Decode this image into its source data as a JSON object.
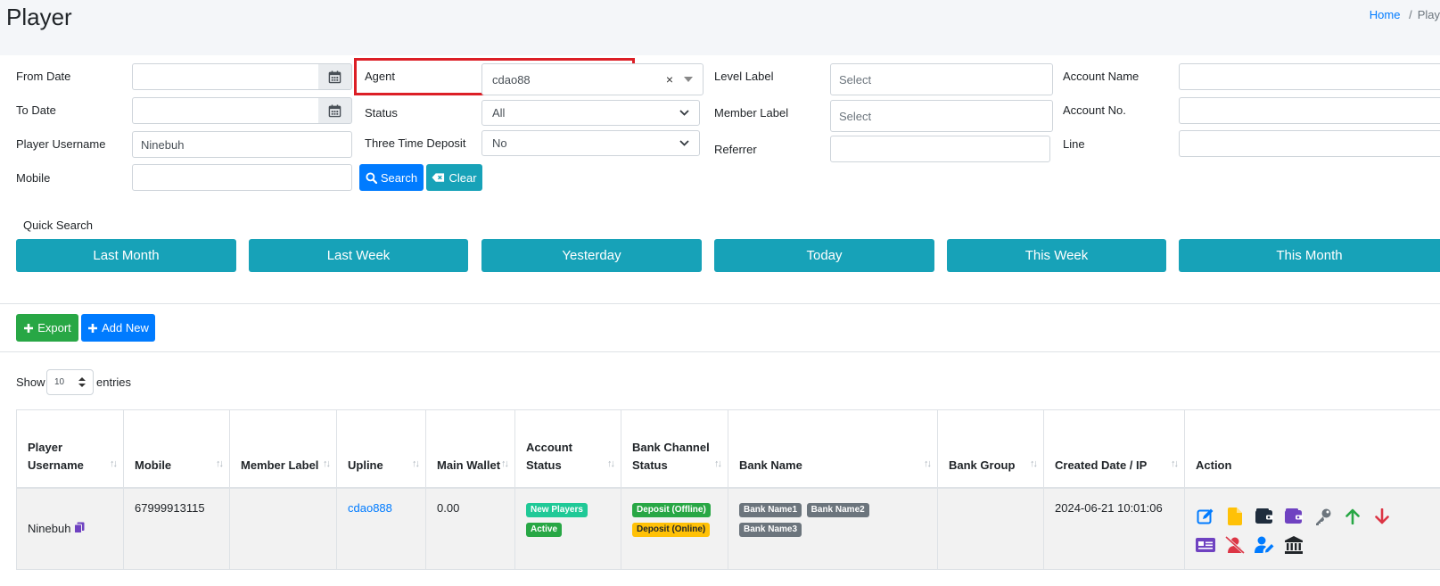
{
  "page": {
    "title": "Player"
  },
  "breadcrumb": {
    "home": "Home",
    "separator": "/",
    "current": "Play"
  },
  "filters": {
    "from_date": {
      "label": "From Date",
      "value": ""
    },
    "to_date": {
      "label": "To Date",
      "value": ""
    },
    "player_username": {
      "label": "Player Username",
      "value": "Ninebuh"
    },
    "mobile": {
      "label": "Mobile",
      "value": ""
    },
    "agent": {
      "label": "Agent",
      "value": "cdao88",
      "clear": "×"
    },
    "status": {
      "label": "Status",
      "value": "All"
    },
    "three_time_deposit": {
      "label": "Three Time Deposit",
      "value": "No"
    },
    "level_label": {
      "label": "Level Label",
      "placeholder": "Select"
    },
    "member_label": {
      "label": "Member Label",
      "placeholder": "Select"
    },
    "referrer": {
      "label": "Referrer",
      "value": ""
    },
    "account_name": {
      "label": "Account Name",
      "value": ""
    },
    "account_no": {
      "label": "Account No.",
      "value": ""
    },
    "line": {
      "label": "Line",
      "value": ""
    },
    "search_button": "Search",
    "clear_button": "Clear"
  },
  "quick_search": {
    "label": "Quick Search",
    "buttons": [
      "Last Month",
      "Last Week",
      "Yesterday",
      "Today",
      "This Week",
      "This Month"
    ]
  },
  "toolbar": {
    "export": "Export",
    "add_new": "Add New"
  },
  "entries": {
    "show": "Show",
    "value": "10",
    "suffix": "entries"
  },
  "table": {
    "columns": [
      "Player Username",
      "Mobile",
      "Member Label",
      "Upline",
      "Main Wallet",
      "Account Status",
      "Bank Channel Status",
      "Bank Name",
      "Bank Group",
      "Created Date / IP",
      "Action"
    ],
    "rows": [
      {
        "player_username": "Ninebuh",
        "mobile": "67999913115",
        "member_label": "",
        "upline": "cdao888",
        "main_wallet": "0.00",
        "account_status": [
          "New Players",
          "Active"
        ],
        "bank_channel_status": [
          "Deposit (Offline)",
          "Deposit (Online)"
        ],
        "bank_name": [
          "Bank Name1",
          "Bank Name2",
          "Bank Name3"
        ],
        "bank_group": "",
        "created_date": "2024-06-21 10:01:06",
        "actions": [
          "edit-icon",
          "file-icon",
          "wallet-icon",
          "purse-icon",
          "key-icon",
          "arrow-up-icon",
          "arrow-down-icon",
          "money-check-icon",
          "user-slash-icon",
          "user-edit-icon",
          "bank-icon"
        ]
      }
    ]
  },
  "colors": {
    "primary": "#007bff",
    "info": "#17a2b8",
    "success": "#28a745",
    "highlight": "#dc1f26"
  }
}
